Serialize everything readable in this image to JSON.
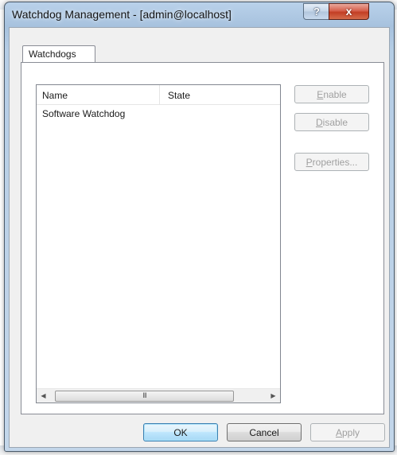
{
  "window": {
    "title": "Watchdog Management - [admin@localhost]",
    "help_glyph": "?",
    "close_glyph": "x"
  },
  "tabs": [
    {
      "label": "Watchdogs"
    }
  ],
  "list": {
    "columns": [
      "Name",
      "State"
    ],
    "rows": [
      {
        "name": "Software Watchdog",
        "state": ""
      }
    ],
    "scrollbar": {
      "left_glyph": "◀",
      "right_glyph": "▶",
      "grip_glyph": "III"
    }
  },
  "side_buttons": {
    "enable": {
      "mnemonic": "E",
      "rest": "nable",
      "enabled": false
    },
    "disable": {
      "mnemonic": "D",
      "rest": "isable",
      "enabled": false
    },
    "properties": {
      "mnemonic": "P",
      "rest": "roperties...",
      "enabled": false
    }
  },
  "footer_buttons": {
    "ok": "OK",
    "cancel": "Cancel",
    "apply": {
      "mnemonic": "A",
      "rest": "pply",
      "enabled": false
    }
  }
}
